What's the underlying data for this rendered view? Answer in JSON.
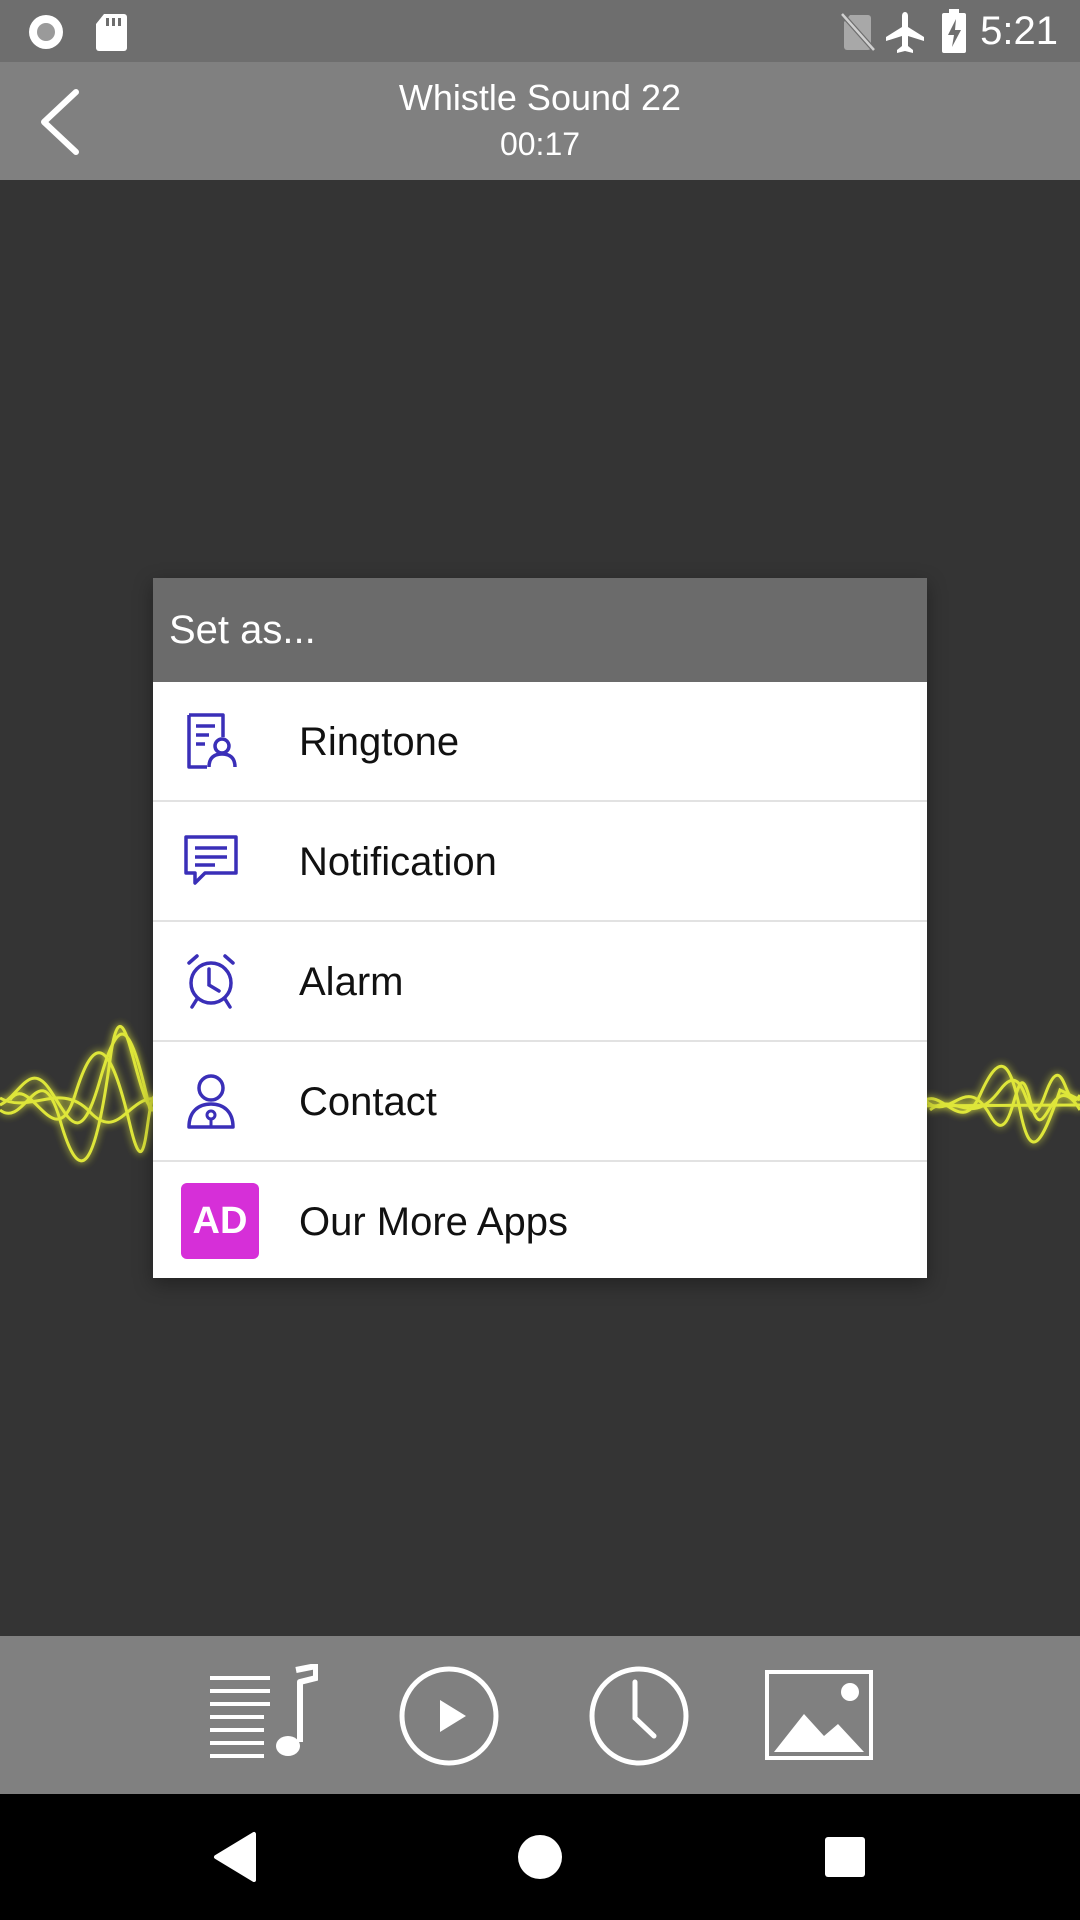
{
  "status_bar": {
    "time": "5:21",
    "icons": [
      "record-icon",
      "sd-card-icon",
      "no-sim-icon",
      "airplane-icon",
      "battery-charging-icon"
    ]
  },
  "header": {
    "title": "Whistle Sound 22",
    "subtitle": "00:17",
    "back_icon": "back-chevron-icon"
  },
  "dialog": {
    "title": "Set as...",
    "items": [
      {
        "label": "Ringtone",
        "icon": "ringtone-contact-card-icon"
      },
      {
        "label": "Notification",
        "icon": "chat-bubble-icon"
      },
      {
        "label": "Alarm",
        "icon": "alarm-clock-icon"
      },
      {
        "label": "Contact",
        "icon": "contact-person-icon"
      },
      {
        "label": "Our More Apps",
        "icon": "ad-badge-icon",
        "badge": "AD"
      }
    ]
  },
  "toolbar": {
    "buttons": [
      "playlist-icon",
      "play-icon",
      "clock-icon",
      "wallpaper-image-icon"
    ]
  },
  "nav": {
    "buttons": [
      "nav-back-icon",
      "nav-home-icon",
      "nav-recents-icon"
    ]
  },
  "colors": {
    "background": "#343434",
    "bars": "#808080",
    "status_bar": "#6e6e6e",
    "dialog_header": "#6b6b6b",
    "icon_accent": "#3a2fb8",
    "ad_badge": "#d62fd8",
    "waveform": "#e8f03a"
  }
}
